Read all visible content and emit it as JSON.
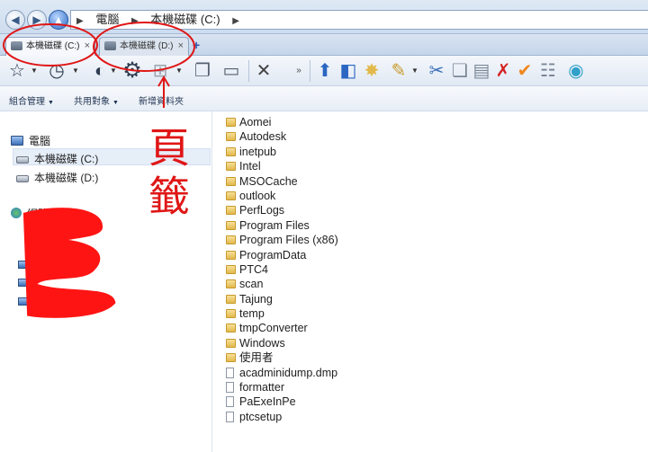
{
  "address": {
    "path": [
      "電腦",
      "本機磁碟 (C:)"
    ]
  },
  "tabs": [
    {
      "label": "本機磁碟 (C:)",
      "active": true
    },
    {
      "label": "本機磁碟 (D:)",
      "active": false
    }
  ],
  "tab_close_glyph": "×",
  "tab_add_glyph": "+",
  "commands": [
    {
      "label": "組合管理"
    },
    {
      "label": "共用對象"
    },
    {
      "label": "新增資料夾"
    }
  ],
  "navpane": {
    "computer": "電腦",
    "drive_c": "本機磁碟 (C:)",
    "drive_d": "本機磁碟 (D:)",
    "network": "網路"
  },
  "files": [
    {
      "name": "Aomei",
      "type": "folder"
    },
    {
      "name": "Autodesk",
      "type": "folder"
    },
    {
      "name": "inetpub",
      "type": "folder"
    },
    {
      "name": "Intel",
      "type": "folder"
    },
    {
      "name": "MSOCache",
      "type": "folder-locked"
    },
    {
      "name": "outlook",
      "type": "folder"
    },
    {
      "name": "PerfLogs",
      "type": "folder"
    },
    {
      "name": "Program Files",
      "type": "folder"
    },
    {
      "name": "Program Files (x86)",
      "type": "folder"
    },
    {
      "name": "ProgramData",
      "type": "folder"
    },
    {
      "name": "PTC4",
      "type": "folder"
    },
    {
      "name": "scan",
      "type": "folder"
    },
    {
      "name": "Tajung",
      "type": "folder"
    },
    {
      "name": "temp",
      "type": "folder"
    },
    {
      "name": "tmpConverter",
      "type": "folder"
    },
    {
      "name": "Windows",
      "type": "folder"
    },
    {
      "name": "使用者",
      "type": "folder"
    },
    {
      "name": "acadminidump.dmp",
      "type": "file"
    },
    {
      "name": "formatter",
      "type": "file"
    },
    {
      "name": "PaExeInPe",
      "type": "file"
    },
    {
      "name": "ptcsetup",
      "type": "file"
    }
  ],
  "annotation": {
    "text": "頁籤",
    "color": "#e01616"
  },
  "colors": {
    "accent": "#2b55a8",
    "annotation_red": "#e01616",
    "selection": "#e6eef8"
  }
}
